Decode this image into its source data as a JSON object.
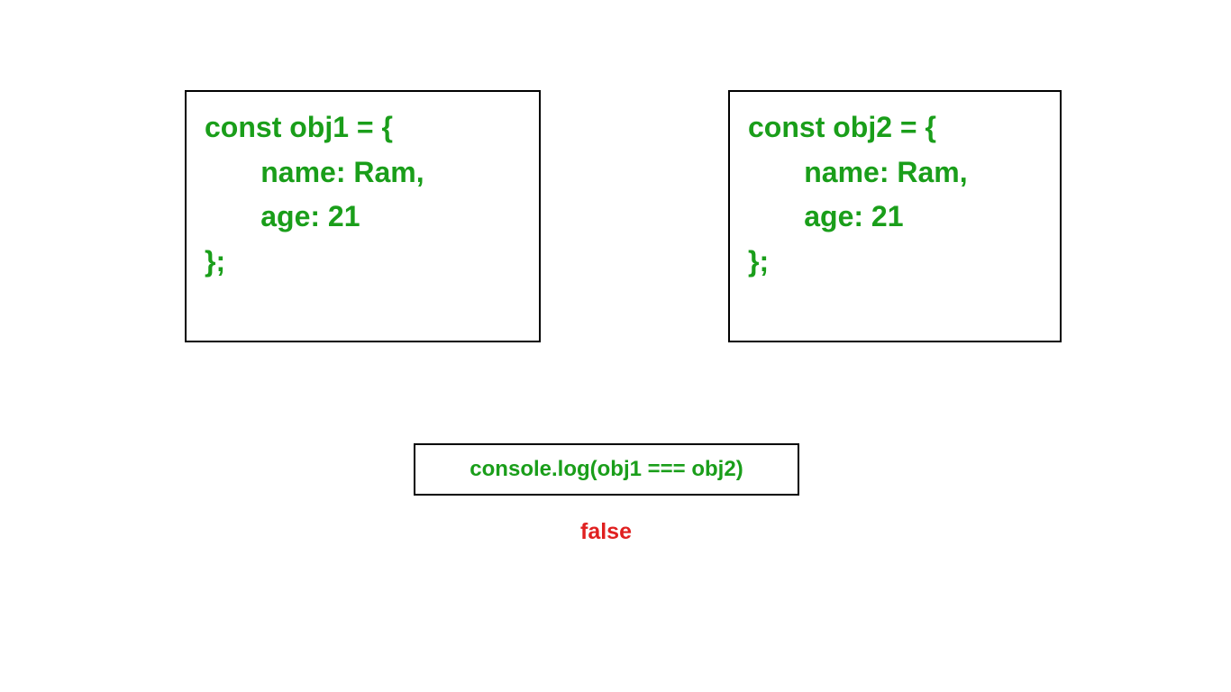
{
  "box_left": {
    "code": "const obj1 = {\n       name: Ram,\n       age: 21\n};"
  },
  "box_right": {
    "code": "const obj2 = {\n       name: Ram,\n       age: 21\n};"
  },
  "command": {
    "text": "console.log(obj1 === obj2)"
  },
  "result": {
    "text": "false"
  },
  "colors": {
    "code_green": "#1a9e1a",
    "result_red": "#e02020",
    "border_black": "#000000"
  }
}
